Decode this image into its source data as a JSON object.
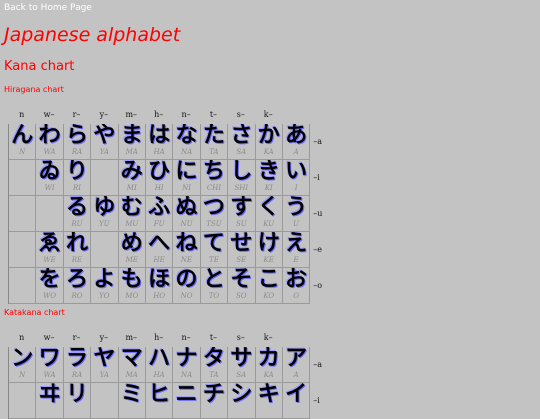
{
  "nav": {
    "back_label": "Back to Home Page"
  },
  "page": {
    "title": "Japanese alphabet",
    "section": "Kana chart"
  },
  "hiragana": {
    "title": "Hiragana chart",
    "columns": [
      "n",
      "w–",
      "r–",
      "y–",
      "m–",
      "h–",
      "n–",
      "t–",
      "s–",
      "k–",
      ""
    ],
    "vowels": [
      "–a",
      "–i",
      "–u",
      "–e",
      "–o"
    ],
    "rows": [
      [
        {
          "k": "ん",
          "r": "N"
        },
        {
          "k": "わ",
          "r": "WA"
        },
        {
          "k": "ら",
          "r": "RA"
        },
        {
          "k": "や",
          "r": "YA"
        },
        {
          "k": "ま",
          "r": "MA"
        },
        {
          "k": "は",
          "r": "HA"
        },
        {
          "k": "な",
          "r": "NA"
        },
        {
          "k": "た",
          "r": "TA"
        },
        {
          "k": "さ",
          "r": "SA"
        },
        {
          "k": "か",
          "r": "KA"
        },
        {
          "k": "あ",
          "r": "A"
        }
      ],
      [
        {
          "k": "",
          "r": ""
        },
        {
          "k": "ゐ",
          "r": "WI"
        },
        {
          "k": "り",
          "r": "RI"
        },
        {
          "k": "",
          "r": ""
        },
        {
          "k": "み",
          "r": "MI"
        },
        {
          "k": "ひ",
          "r": "HI"
        },
        {
          "k": "に",
          "r": "NI"
        },
        {
          "k": "ち",
          "r": "CHI"
        },
        {
          "k": "し",
          "r": "SHI"
        },
        {
          "k": "き",
          "r": "KI"
        },
        {
          "k": "い",
          "r": "I"
        }
      ],
      [
        {
          "k": "",
          "r": ""
        },
        {
          "k": "",
          "r": ""
        },
        {
          "k": "る",
          "r": "RU"
        },
        {
          "k": "ゆ",
          "r": "YU"
        },
        {
          "k": "む",
          "r": "MU"
        },
        {
          "k": "ふ",
          "r": "FU"
        },
        {
          "k": "ぬ",
          "r": "NU"
        },
        {
          "k": "つ",
          "r": "TSU"
        },
        {
          "k": "す",
          "r": "SU"
        },
        {
          "k": "く",
          "r": "KU"
        },
        {
          "k": "う",
          "r": "U"
        }
      ],
      [
        {
          "k": "",
          "r": ""
        },
        {
          "k": "ゑ",
          "r": "WE"
        },
        {
          "k": "れ",
          "r": "RE"
        },
        {
          "k": "",
          "r": ""
        },
        {
          "k": "め",
          "r": "ME"
        },
        {
          "k": "へ",
          "r": "HE"
        },
        {
          "k": "ね",
          "r": "NE"
        },
        {
          "k": "て",
          "r": "TE"
        },
        {
          "k": "せ",
          "r": "SE"
        },
        {
          "k": "け",
          "r": "KE"
        },
        {
          "k": "え",
          "r": "E"
        }
      ],
      [
        {
          "k": "",
          "r": ""
        },
        {
          "k": "を",
          "r": "WO"
        },
        {
          "k": "ろ",
          "r": "RO"
        },
        {
          "k": "よ",
          "r": "YO"
        },
        {
          "k": "も",
          "r": "MO"
        },
        {
          "k": "ほ",
          "r": "HO"
        },
        {
          "k": "の",
          "r": "NO"
        },
        {
          "k": "と",
          "r": "TO"
        },
        {
          "k": "そ",
          "r": "SO"
        },
        {
          "k": "こ",
          "r": "KO"
        },
        {
          "k": "お",
          "r": "O"
        }
      ]
    ]
  },
  "katakana": {
    "title": "Katakana chart",
    "columns": [
      "n",
      "w–",
      "r–",
      "y–",
      "m–",
      "h–",
      "n–",
      "t–",
      "s–",
      "k–",
      ""
    ],
    "vowels": [
      "–a",
      "–i"
    ],
    "rows": [
      [
        {
          "k": "ン",
          "r": "N"
        },
        {
          "k": "ワ",
          "r": "WA"
        },
        {
          "k": "ラ",
          "r": "RA"
        },
        {
          "k": "ヤ",
          "r": "YA"
        },
        {
          "k": "マ",
          "r": "MA"
        },
        {
          "k": "ハ",
          "r": "HA"
        },
        {
          "k": "ナ",
          "r": "NA"
        },
        {
          "k": "タ",
          "r": "TA"
        },
        {
          "k": "サ",
          "r": "SA"
        },
        {
          "k": "カ",
          "r": "KA"
        },
        {
          "k": "ア",
          "r": "A"
        }
      ],
      [
        {
          "k": "",
          "r": ""
        },
        {
          "k": "ヰ",
          "r": ""
        },
        {
          "k": "リ",
          "r": ""
        },
        {
          "k": "",
          "r": ""
        },
        {
          "k": "ミ",
          "r": ""
        },
        {
          "k": "ヒ",
          "r": ""
        },
        {
          "k": "ニ",
          "r": ""
        },
        {
          "k": "チ",
          "r": ""
        },
        {
          "k": "シ",
          "r": ""
        },
        {
          "k": "キ",
          "r": ""
        },
        {
          "k": "イ",
          "r": ""
        }
      ]
    ]
  }
}
